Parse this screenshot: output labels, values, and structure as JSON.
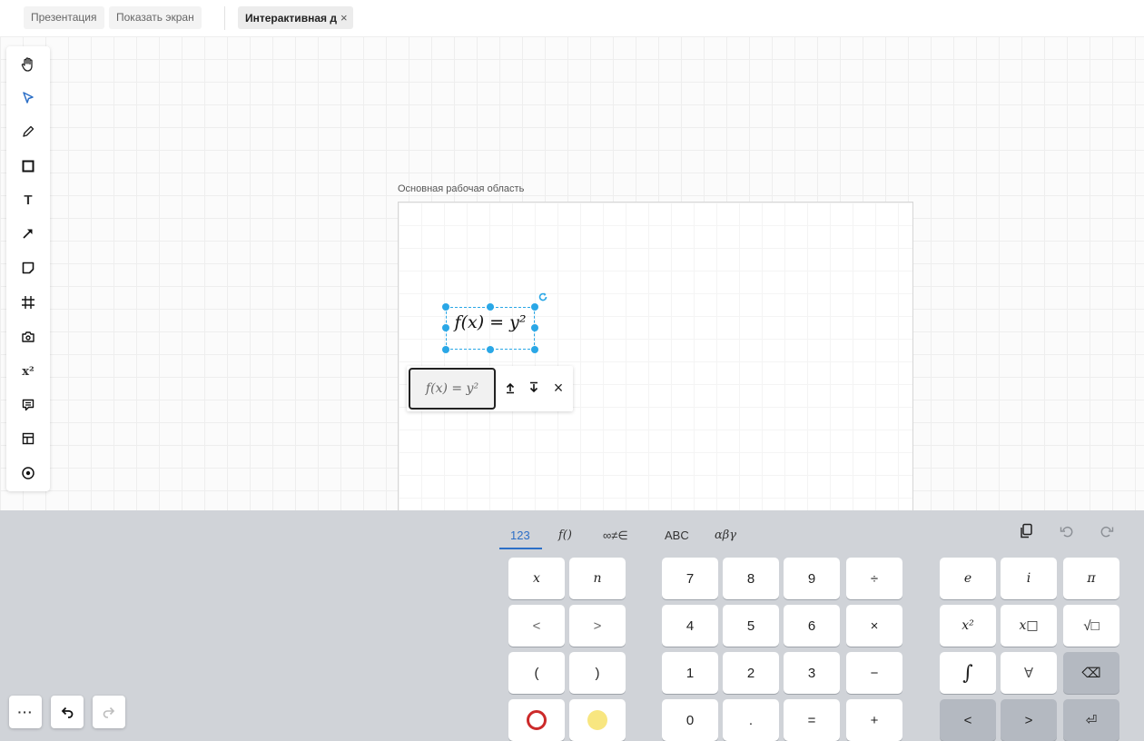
{
  "tabs": [
    "Презентация",
    "Показать экран",
    "Интерактивная д"
  ],
  "tab_close": "×",
  "workarea": {
    "label": "Основная рабочая область"
  },
  "toolbar": {
    "tools": [
      "hand-icon",
      "select-arrow-icon",
      "pencil-icon",
      "rectangle-icon",
      "text-icon",
      "arrow-icon",
      "sticky-note-icon",
      "frame-icon",
      "camera-icon",
      "formula-icon",
      "comment-icon",
      "table-icon",
      "pointer-icon"
    ],
    "text_tool_label": "T",
    "formula_tool_label": "x²"
  },
  "formula": {
    "display": "f(x) = y²"
  },
  "formula_editor": {
    "value": "f(x) = y²",
    "close": "×"
  },
  "bottom_controls": {
    "more": "···"
  },
  "keyboard": {
    "tabs": [
      "123",
      "f()",
      "∞≠∈",
      "ABC",
      "αβγ"
    ],
    "active_tab": "123",
    "variables_block": [
      "x",
      "n",
      "<",
      ">",
      "(",
      ")"
    ],
    "digits_block": [
      "7",
      "8",
      "9",
      "÷",
      "4",
      "5",
      "6",
      "×",
      "1",
      "2",
      "3",
      "−",
      "0",
      ".",
      "=",
      "+"
    ],
    "functions_block": [
      "e",
      "i",
      "π",
      "x²",
      "x□",
      "√□",
      "∫",
      "∀",
      "⌫",
      "<",
      ">",
      "⏎"
    ],
    "colors": {
      "red_circle": "#cc2a2a",
      "yellow_circle": "#f8e680",
      "accent": "#2c6fc7",
      "selection": "#2aa7e6"
    }
  }
}
